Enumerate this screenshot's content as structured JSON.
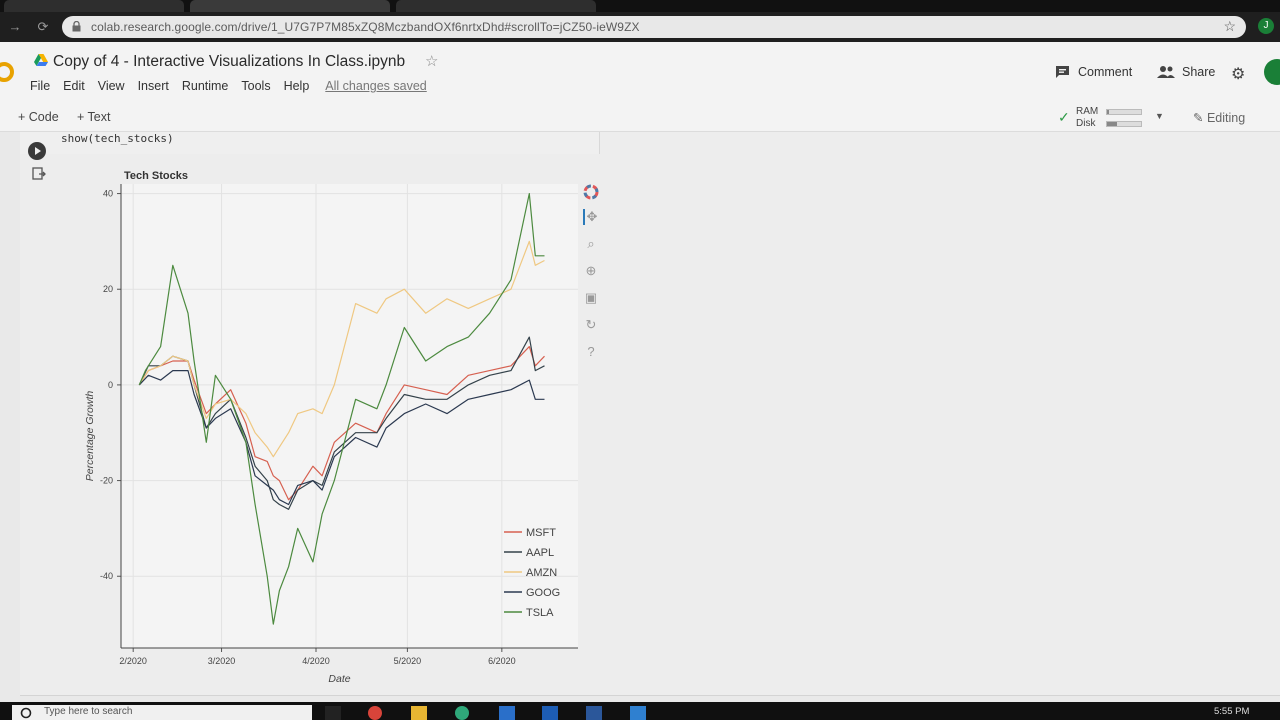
{
  "browser": {
    "url": "colab.research.google.com/drive/1_U7G7P7M85xZQ8MczbandOXf6nrtxDhd#scrollTo=jCZ50-ieW9ZX"
  },
  "notebook": {
    "title": "Copy of 4 - Interactive Visualizations In Class.ipynb",
    "menu": [
      "File",
      "Edit",
      "View",
      "Insert",
      "Runtime",
      "Tools",
      "Help"
    ],
    "save_status": "All changes saved",
    "comment_label": "Comment",
    "share_label": "Share",
    "add_code_label": "+ Code",
    "add_text_label": "+ Text",
    "ram_label": "RAM",
    "disk_label": "Disk",
    "ram_usage": 0.05,
    "disk_usage": 0.3,
    "editing_label": "Editing",
    "cell_code": "show(tech_stocks)"
  },
  "taskbar": {
    "search_placeholder": "Type here to search",
    "clock": "5:55 PM"
  },
  "chart_data": {
    "type": "line",
    "title": "Tech Stocks",
    "xlabel": "Date",
    "ylabel": "Percentage Growth",
    "x_ticks": [
      "2/2020",
      "3/2020",
      "4/2020",
      "5/2020",
      "6/2020"
    ],
    "y_ticks": [
      40,
      20,
      0,
      -20,
      -40
    ],
    "ylim": [
      -55,
      42
    ],
    "xlim": [
      "2020-01-28",
      "2020-06-26"
    ],
    "grid": true,
    "legend_position": "bottom-right",
    "series": [
      {
        "name": "MSFT",
        "color": "#d66050",
        "x": [
          "2020-02-03",
          "2020-02-06",
          "2020-02-10",
          "2020-02-14",
          "2020-02-19",
          "2020-02-21",
          "2020-02-25",
          "2020-02-28",
          "2020-03-04",
          "2020-03-09",
          "2020-03-12",
          "2020-03-16",
          "2020-03-18",
          "2020-03-20",
          "2020-03-23",
          "2020-03-26",
          "2020-03-31",
          "2020-04-03",
          "2020-04-07",
          "2020-04-14",
          "2020-04-21",
          "2020-04-24",
          "2020-04-30",
          "2020-05-07",
          "2020-05-14",
          "2020-05-21",
          "2020-05-28",
          "2020-06-04",
          "2020-06-10",
          "2020-06-12",
          "2020-06-15"
        ],
        "values": [
          0,
          3,
          4,
          5,
          5,
          1,
          -6,
          -4,
          -1,
          -8,
          -15,
          -16,
          -19,
          -20,
          -24,
          -22,
          -17,
          -19,
          -12,
          -8,
          -10,
          -6,
          0,
          -1,
          -2,
          2,
          3,
          4,
          8,
          4,
          6
        ]
      },
      {
        "name": "AAPL",
        "color": "#34424a",
        "x": [
          "2020-02-03",
          "2020-02-06",
          "2020-02-10",
          "2020-02-14",
          "2020-02-19",
          "2020-02-21",
          "2020-02-25",
          "2020-02-28",
          "2020-03-04",
          "2020-03-09",
          "2020-03-12",
          "2020-03-16",
          "2020-03-18",
          "2020-03-20",
          "2020-03-23",
          "2020-03-26",
          "2020-03-31",
          "2020-04-03",
          "2020-04-07",
          "2020-04-14",
          "2020-04-21",
          "2020-04-24",
          "2020-04-30",
          "2020-05-07",
          "2020-05-14",
          "2020-05-21",
          "2020-05-28",
          "2020-06-04",
          "2020-06-10",
          "2020-06-12",
          "2020-06-15"
        ],
        "values": [
          0,
          4,
          4,
          6,
          5,
          0,
          -9,
          -6,
          -3,
          -11,
          -17,
          -20,
          -24,
          -25,
          -26,
          -22,
          -20,
          -21,
          -14,
          -10,
          -10,
          -7,
          -2,
          -3,
          -3,
          0,
          2,
          3,
          10,
          3,
          4
        ]
      },
      {
        "name": "AMZN",
        "color": "#efc882",
        "x": [
          "2020-02-03",
          "2020-02-06",
          "2020-02-10",
          "2020-02-14",
          "2020-02-19",
          "2020-02-21",
          "2020-02-25",
          "2020-02-28",
          "2020-03-04",
          "2020-03-09",
          "2020-03-12",
          "2020-03-16",
          "2020-03-18",
          "2020-03-20",
          "2020-03-23",
          "2020-03-26",
          "2020-03-31",
          "2020-04-03",
          "2020-04-07",
          "2020-04-14",
          "2020-04-21",
          "2020-04-24",
          "2020-04-30",
          "2020-05-07",
          "2020-05-14",
          "2020-05-21",
          "2020-05-28",
          "2020-06-04",
          "2020-06-10",
          "2020-06-12",
          "2020-06-15"
        ],
        "values": [
          0,
          3,
          4,
          6,
          5,
          0,
          -7,
          -4,
          -3,
          -6,
          -10,
          -13,
          -15,
          -13,
          -10,
          -6,
          -5,
          -6,
          0,
          17,
          15,
          18,
          20,
          15,
          18,
          16,
          18,
          20,
          30,
          25,
          26
        ]
      },
      {
        "name": "GOOG",
        "color": "#2b3950",
        "x": [
          "2020-02-03",
          "2020-02-06",
          "2020-02-10",
          "2020-02-14",
          "2020-02-19",
          "2020-02-21",
          "2020-02-25",
          "2020-02-28",
          "2020-03-04",
          "2020-03-09",
          "2020-03-12",
          "2020-03-16",
          "2020-03-18",
          "2020-03-20",
          "2020-03-23",
          "2020-03-26",
          "2020-03-31",
          "2020-04-03",
          "2020-04-07",
          "2020-04-14",
          "2020-04-21",
          "2020-04-24",
          "2020-04-30",
          "2020-05-07",
          "2020-05-14",
          "2020-05-21",
          "2020-05-28",
          "2020-06-04",
          "2020-06-10",
          "2020-06-12",
          "2020-06-15"
        ],
        "values": [
          0,
          2,
          1,
          3,
          3,
          -2,
          -9,
          -7,
          -5,
          -12,
          -19,
          -21,
          -22,
          -24,
          -25,
          -21,
          -20,
          -22,
          -15,
          -11,
          -13,
          -9,
          -6,
          -4,
          -6,
          -3,
          -2,
          -1,
          1,
          -3,
          -3
        ]
      },
      {
        "name": "TSLA",
        "color": "#4c8a3f",
        "x": [
          "2020-02-03",
          "2020-02-05",
          "2020-02-10",
          "2020-02-14",
          "2020-02-19",
          "2020-02-21",
          "2020-02-25",
          "2020-02-28",
          "2020-03-04",
          "2020-03-09",
          "2020-03-12",
          "2020-03-16",
          "2020-03-18",
          "2020-03-20",
          "2020-03-23",
          "2020-03-26",
          "2020-03-31",
          "2020-04-03",
          "2020-04-07",
          "2020-04-14",
          "2020-04-21",
          "2020-04-24",
          "2020-04-30",
          "2020-05-07",
          "2020-05-14",
          "2020-05-21",
          "2020-05-28",
          "2020-06-04",
          "2020-06-10",
          "2020-06-12",
          "2020-06-15"
        ],
        "values": [
          0,
          3,
          8,
          25,
          15,
          5,
          -12,
          2,
          -3,
          -12,
          -25,
          -40,
          -50,
          -43,
          -38,
          -30,
          -37,
          -27,
          -20,
          -3,
          -5,
          0,
          12,
          5,
          8,
          10,
          15,
          22,
          40,
          27,
          27
        ]
      }
    ]
  }
}
